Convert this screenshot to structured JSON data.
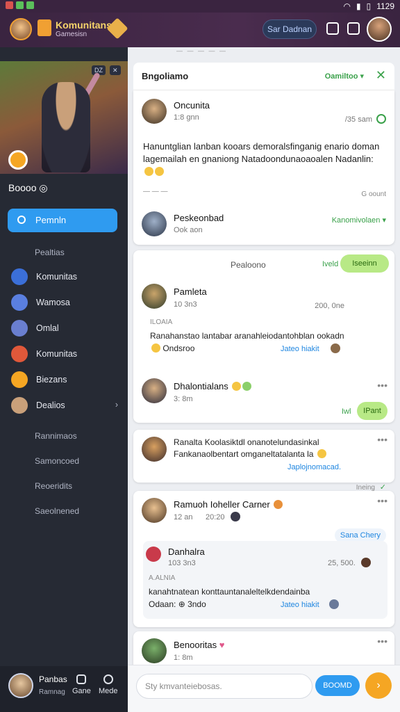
{
  "status": {
    "time": "1129"
  },
  "appbar": {
    "title": "Komunitans",
    "subtitle": "Gamesisn",
    "search_label": "Sar Dadnan"
  },
  "sidebar": {
    "hero_chip": "DZ",
    "name": "Boooo",
    "active": "Pemnln",
    "section": "Pealtias",
    "items": [
      {
        "label": "Komunitas",
        "color": "#3b6fd8"
      },
      {
        "label": "Wamosa",
        "color": "#5a7fe0"
      },
      {
        "label": "Omlal",
        "color": "#6a7fd0"
      },
      {
        "label": "Komunitas",
        "color": "#e0583a"
      },
      {
        "label": "Biezans",
        "color": "#f5a623"
      },
      {
        "label": "Dealios",
        "color": "#c9a07a"
      }
    ],
    "plain": [
      "Rannimaos",
      "Samoncoed",
      "Reoeridits",
      "Saeolnened"
    ],
    "footer": {
      "name": "Panbas",
      "sub": "Ramnag",
      "btn1": "Gane",
      "btn2": "Mede"
    }
  },
  "main": {
    "topline": "— — — — —",
    "header": {
      "title": "Bngoliamo",
      "tab": "Oamiltoo ▾"
    },
    "post1": {
      "author": "Oncunita",
      "time": "1:8 gnn",
      "date": "/35 sam",
      "text": "Hanuntglian lanban kooars demoralsfinganig enario doman lagemailah en gnaniong Natadoondunaoaoalen Nadanlin:",
      "meta": "G oount",
      "reply_name": "Peskeonbad",
      "reply_meta": "Ook aon",
      "reply_action": "Kanomivolaen ▾"
    },
    "post2": {
      "title": "Pealoono",
      "top_link": "Iveld",
      "top_pill": "Iseeinn",
      "author": "Pamleta",
      "time": "10 3n3",
      "date": "200, 0ne",
      "quote": "ILOAIA",
      "text": "Ranahanstao lantabar aranahleiodantohblan ookadn",
      "emoji_text": "Ondsroo",
      "link": "Jateo hiakit"
    },
    "post3": {
      "author": "Dhalontialans",
      "time": "3: 8m",
      "link": "Iwl",
      "pill": "IPant"
    },
    "post4": {
      "text": "Ranalta Koolasiktdl onanotelundasinkal Fankanaolbentart omganeltatalanta la",
      "link": "Japlojnomacad.",
      "foot": "Ineing"
    },
    "post5": {
      "author": "Ramuoh Ioheller Carner",
      "time": "12 an",
      "time2": "20:20",
      "tag": "Sana Chery",
      "sub_author": "Danhalra",
      "sub_time": "103 3n3",
      "sub_date": "25, 500.",
      "quote": "A.ALNIA",
      "text": "kanahtnatean konttauntanaleltelkdendainba",
      "text2": "Odaan: ⊕ 3ndo",
      "link": "Jateo hiakit"
    },
    "post6": {
      "author": "Benooritas",
      "time": "1: 8m"
    }
  },
  "composer": {
    "placeholder": "Sty kmvanteiebosas.",
    "send": "BOOMD",
    "fab": "›"
  }
}
